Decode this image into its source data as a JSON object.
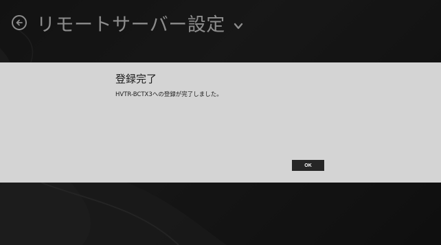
{
  "page": {
    "title": "リモートサーバー設定"
  },
  "dialog": {
    "title": "登録完了",
    "message": "HVTR-BCTX3への登録が完了しました。",
    "ok_label": "OK"
  },
  "icons": {
    "back": "back-arrow-circle-icon",
    "title_menu": "chevron-down-icon"
  },
  "colors": {
    "dialog_background": "#d4d4d4",
    "button_background": "#262626",
    "page_background": "#222222"
  }
}
